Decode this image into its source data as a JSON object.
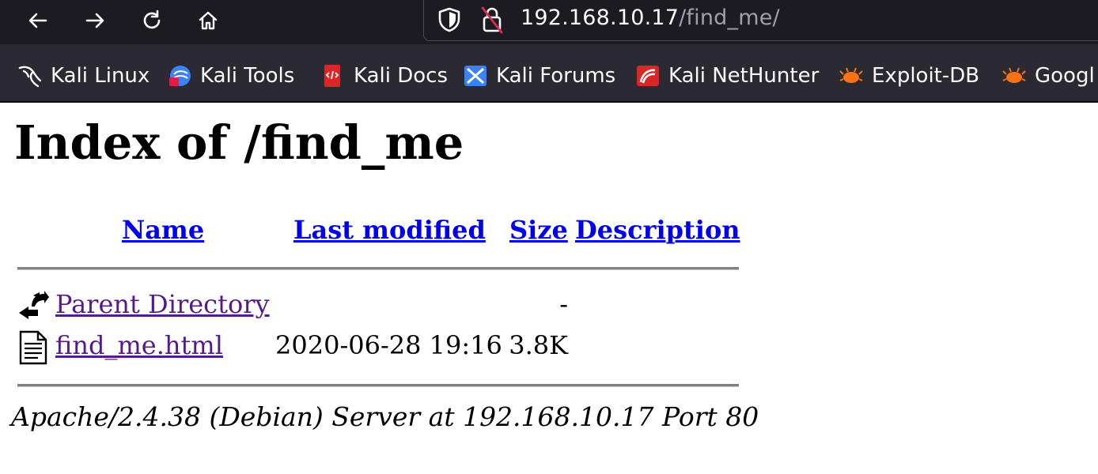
{
  "browser": {
    "url_host": "192.168.10.17",
    "url_path": "/find_me/",
    "nav_icons": [
      "back-arrow-icon",
      "forward-arrow-icon",
      "reload-icon",
      "home-icon"
    ],
    "bookmarks": [
      {
        "label": "Kali Linux",
        "icon": "kali-dragon-icon"
      },
      {
        "label": "Kali Tools",
        "icon": "kali-tools-icon"
      },
      {
        "label": "Kali Docs",
        "icon": "kali-docs-icon"
      },
      {
        "label": "Kali Forums",
        "icon": "kali-forums-icon"
      },
      {
        "label": "Kali NetHunter",
        "icon": "kali-nethunter-icon"
      },
      {
        "label": "Exploit-DB",
        "icon": "exploit-db-icon"
      },
      {
        "label": "Googl",
        "icon": "google-hacking-db-icon"
      }
    ],
    "colors": {
      "toolbar": "#2b2a33",
      "urlbar": "#1c1b22",
      "text": "#fbfbfe"
    }
  },
  "page": {
    "title": "Index of /find_me",
    "headers": {
      "name": "Name",
      "last_modified": "Last modified",
      "size": "Size",
      "description": "Description"
    },
    "rows": [
      {
        "name": "Parent Directory",
        "modified": "",
        "size": "-",
        "icon": "back-folder-icon"
      },
      {
        "name": "find_me.html",
        "modified": "2020-06-28 19:16",
        "size": "3.8K",
        "icon": "text-file-icon"
      }
    ],
    "address": "Apache/2.4.38 (Debian) Server at 192.168.10.17 Port 80",
    "colors": {
      "link": "#0000ee",
      "visited": "#551a8b"
    }
  }
}
